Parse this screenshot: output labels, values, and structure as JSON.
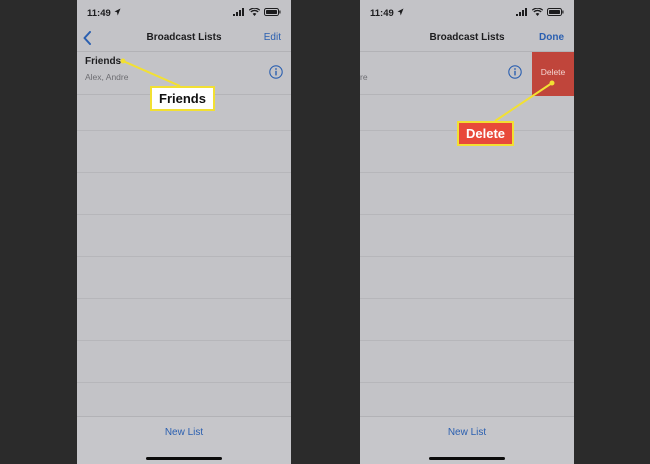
{
  "status_bar": {
    "time": "11:49"
  },
  "left_screen": {
    "nav_title": "Broadcast Lists",
    "nav_action": "Edit",
    "list_row": {
      "title": "Friends",
      "subtitle": "Alex, Andre"
    },
    "new_list_label": "New List"
  },
  "right_screen": {
    "nav_title": "Broadcast Lists",
    "nav_action": "Done",
    "list_row": {
      "subtitle_fragment": "re"
    },
    "delete_action_label": "Delete",
    "new_list_label": "New List"
  },
  "callouts": {
    "friends_label": "Friends",
    "delete_label": "Delete"
  },
  "colors": {
    "accent_blue": "#2a5fb0",
    "delete_red": "#c0453b",
    "callout_border": "#f2e033",
    "callout_red": "#e8493a"
  },
  "icons": [
    "back-chevron-icon",
    "info-icon",
    "signal-icon",
    "wifi-icon",
    "battery-icon",
    "location-arrow-icon"
  ]
}
